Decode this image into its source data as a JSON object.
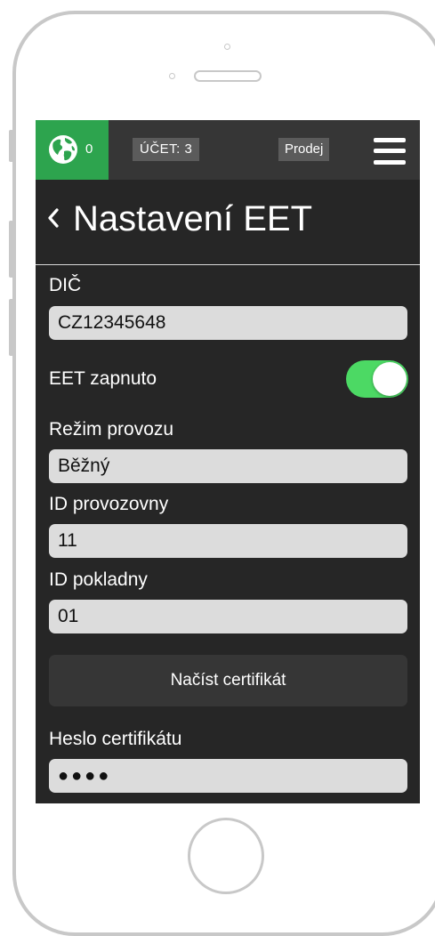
{
  "topbar": {
    "online_count": "0",
    "ucet_label": "ÚČET: 3",
    "prodej_label": "Prodej",
    "globe_color": "#2da44e"
  },
  "header": {
    "title": "Nastavení EET"
  },
  "form": {
    "dic_label": "DIČ",
    "dic_value": "CZ12345648",
    "eet_label": "EET zapnuto",
    "eet_enabled": true,
    "toggle_color": "#4cd964",
    "rezim_label": "Režim provozu",
    "rezim_value": "Běžný",
    "provozovna_label": "ID provozovny",
    "provozovna_value": "11",
    "pokladna_label": "ID pokladny",
    "pokladna_value": "01",
    "load_certificate_label": "Načíst certifikát",
    "password_label": "Heslo certifikátu",
    "password_value": "●●●●"
  },
  "icons": {
    "globe": "globe-icon",
    "menu": "hamburger-menu-icon",
    "back": "chevron-left-icon"
  }
}
